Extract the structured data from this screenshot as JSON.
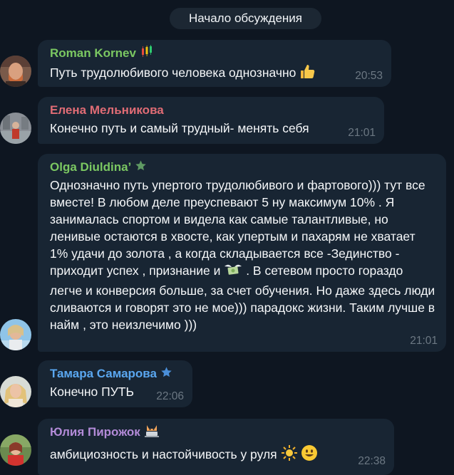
{
  "chat": {
    "divider_label": "Начало обсуждения",
    "messages": [
      {
        "sender": "Roman Kornev",
        "sender_color": "#7bc862",
        "sender_emoji_icon": "candlestick-chart-icon",
        "text": "Путь трудолюбивого человека однозначно",
        "time": "20:53"
      },
      {
        "sender": "Елена Мельникова",
        "sender_color": "#e06c75",
        "text": "Конечно путь и самый трудный- менять себя",
        "time": "21:01"
      },
      {
        "sender": "Olga Diuldina’",
        "sender_color": "#7bc862",
        "sender_badge_icon": "star-icon",
        "text_before_emoji": "Однозначно путь упертого трудолюбивого и фартового))) тут все вместе! В любом деле преуспевают 5 ну максимум 10% . Я занималась спортом и видела как самые талантливые, но ленивые остаются в хвосте, как упертым и пахарям не хватает 1% удачи до золота , а когда складывается все -Зединство - приходит успех , признание и",
        "text_after_emoji": ". В сетевом просто гораздо легче и конверсия больше, за счет обучения. Но даже здесь люди сливаются и говорят это не мое))) парадокс жизни. Таким лучше в найм , это неизлечимо )))",
        "time": "21:01"
      },
      {
        "sender": "Тамара Самарова",
        "sender_color": "#5aa7f0",
        "sender_badge_icon": "star-icon",
        "text": "Конечно ПУТЬ",
        "time": "22:06"
      },
      {
        "sender": "Юлия Пирожок",
        "sender_color": "#b38bd8",
        "sender_emoji_icon": "cat-laptop-icon",
        "text": "амбициозность и настойчивость  у руля",
        "time": "22:38"
      }
    ]
  }
}
